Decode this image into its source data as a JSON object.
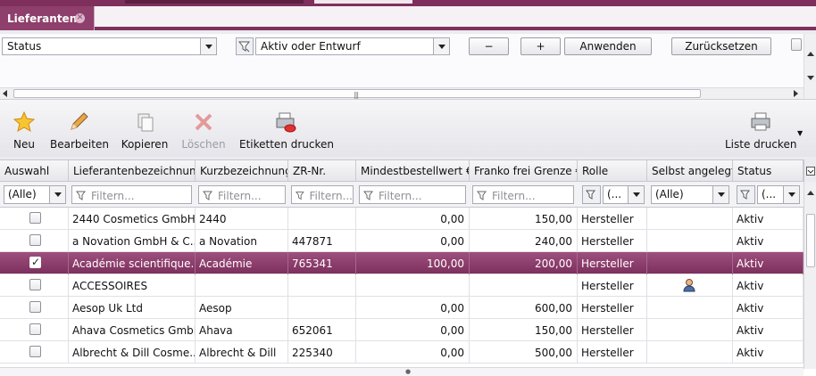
{
  "tab": {
    "title": "Lieferanten",
    "close_icon": "close-icon"
  },
  "filter": {
    "field": "Status",
    "operator_icon": "filter-icon",
    "value": "Aktiv oder Entwurf",
    "minus_label": "−",
    "plus_label": "+",
    "apply_label": "Anwenden",
    "reset_label": "Zurücksetzen"
  },
  "toolbar": {
    "new": "Neu",
    "edit": "Bearbeiten",
    "copy": "Kopieren",
    "delete": "Löschen",
    "labels": "Etiketten drucken",
    "print_list": "Liste drucken"
  },
  "grid": {
    "columns": [
      "Auswahl",
      "Lieferantenbezeichnung",
      "Kurzbezeichnung",
      "ZR-Nr.",
      "Mindestbestellwert €",
      "Franko frei Grenze €",
      "Rolle",
      "Selbst angelegt",
      "Status"
    ],
    "filters": {
      "auswahl": "(Alle)",
      "placeholder": "Filtern...",
      "rolle": "(...",
      "selbst": "(Alle)",
      "status": "(..."
    },
    "rows": [
      {
        "checked": false,
        "name": "2440 Cosmetics GmbH",
        "short": "2440",
        "zr": "",
        "min": "0,00",
        "franko": "150,00",
        "rolle": "Hersteller",
        "selbst": "",
        "status": "Aktiv"
      },
      {
        "checked": false,
        "name": "a Novation GmbH & C...",
        "short": "a Novation",
        "zr": "447871",
        "min": "0,00",
        "franko": "240,00",
        "rolle": "Hersteller",
        "selbst": "",
        "status": "Aktiv"
      },
      {
        "checked": true,
        "name": "Académie scientifique...",
        "short": "Académie",
        "zr": "765341",
        "min": "100,00",
        "franko": "200,00",
        "rolle": "Hersteller",
        "selbst": "",
        "status": "Aktiv"
      },
      {
        "checked": false,
        "name": "ACCESSOIRES",
        "short": "",
        "zr": "",
        "min": "",
        "franko": "",
        "rolle": "Hersteller",
        "selbst": "user-icon",
        "status": "Aktiv"
      },
      {
        "checked": false,
        "name": "Aesop Uk Ltd",
        "short": "Aesop",
        "zr": "",
        "min": "0,00",
        "franko": "600,00",
        "rolle": "Hersteller",
        "selbst": "",
        "status": "Aktiv"
      },
      {
        "checked": false,
        "name": "Ahava Cosmetics GmbH",
        "short": "Ahava",
        "zr": "652061",
        "min": "0,00",
        "franko": "150,00",
        "rolle": "Hersteller",
        "selbst": "",
        "status": "Aktiv"
      },
      {
        "checked": false,
        "name": "Albrecht & Dill Cosme...",
        "short": "Albrecht & Dill",
        "zr": "225340",
        "min": "0,00",
        "franko": "500,00",
        "rolle": "Hersteller",
        "selbst": "",
        "status": "Aktiv"
      }
    ]
  },
  "colors": {
    "accent": "#7e2f5c",
    "selected_row": "#8a3b69"
  }
}
